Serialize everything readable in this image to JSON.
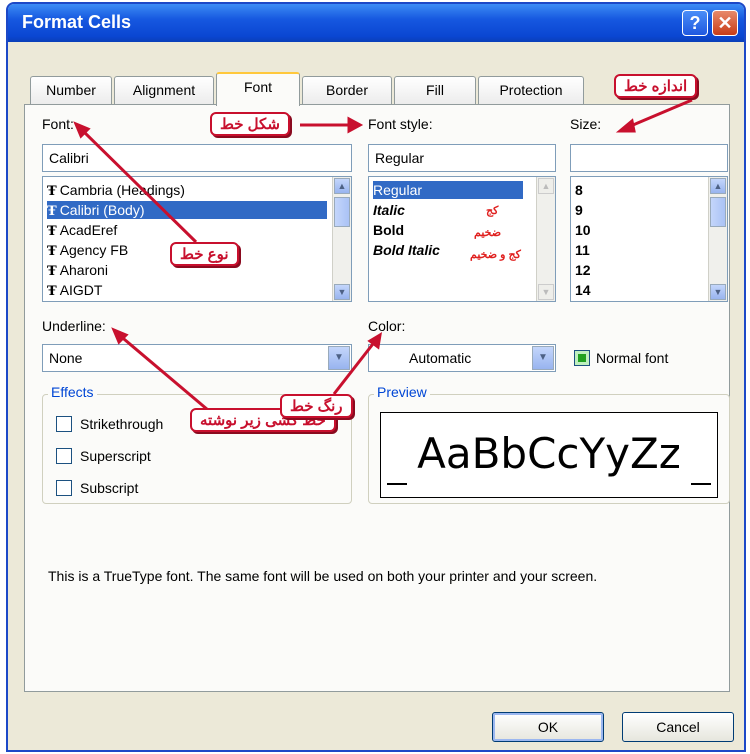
{
  "window": {
    "title": "Format Cells",
    "help_glyph": "?",
    "close_glyph": "✕"
  },
  "tabs": [
    "Number",
    "Alignment",
    "Font",
    "Border",
    "Fill",
    "Protection"
  ],
  "active_tab": "Font",
  "font": {
    "label": "Font:",
    "value": "Calibri",
    "items": [
      "Cambria (Headings)",
      "Calibri (Body)",
      "AcadEref",
      "Agency FB",
      "Aharoni",
      "AIGDT"
    ],
    "selected_index": 1,
    "truetype_glyph": "Ŧ"
  },
  "font_style": {
    "label": "Font style:",
    "value": "Regular",
    "items": [
      "Regular",
      "Italic",
      "Bold",
      "Bold Italic"
    ],
    "selected_index": 0
  },
  "size": {
    "label": "Size:",
    "value": "",
    "items": [
      "8",
      "9",
      "10",
      "11",
      "12",
      "14"
    ]
  },
  "underline": {
    "label": "Underline:",
    "value": "None"
  },
  "color": {
    "label": "Color:",
    "value": "Automatic"
  },
  "normal_font": {
    "label": "Normal font",
    "checked": true
  },
  "effects": {
    "title": "Effects",
    "items": [
      {
        "label": "Strikethrough",
        "checked": false
      },
      {
        "label": "Superscript",
        "checked": false
      },
      {
        "label": "Subscript",
        "checked": false
      }
    ]
  },
  "preview": {
    "title": "Preview",
    "sample": "AaBbCcYyZz"
  },
  "description": "This is a TrueType font.  The same font will be used on both your printer and your screen.",
  "buttons": {
    "ok": "OK",
    "cancel": "Cancel"
  },
  "annotations": {
    "font_size": "اندازه خط",
    "font_style": "شکل خط",
    "font_type": "نوع خط",
    "underline": "خط کشی زیر نوشته",
    "color": "رنگ خط",
    "italic_note": "کج",
    "bold_note": "ضخیم",
    "bold_italic_note": "کج و ضخیم"
  },
  "colors": {
    "titlebar": "#0a46d2",
    "selection": "#316ac5",
    "annotation": "#c8102e"
  }
}
